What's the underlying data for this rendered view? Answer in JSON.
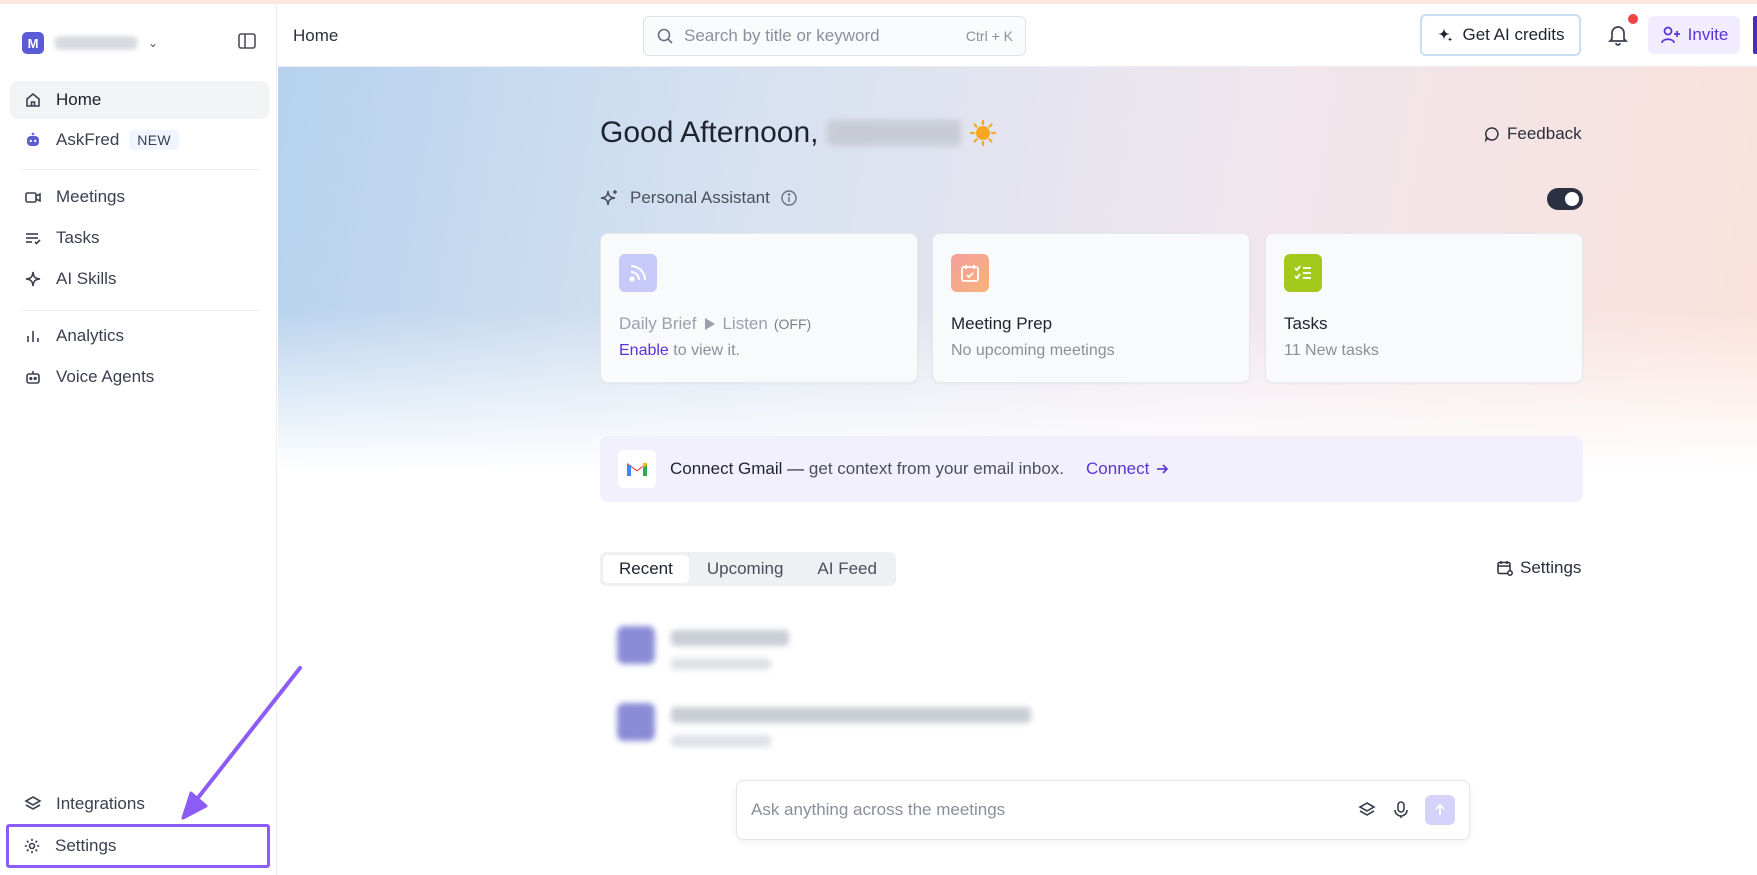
{
  "colors": {
    "accent": "#5b32d6",
    "highlight": "#8b5cf6",
    "notification": "#ef4444"
  },
  "sidebar": {
    "workspace_initial": "M",
    "items": [
      {
        "label": "Home",
        "icon": "home-icon"
      },
      {
        "label": "AskFred",
        "badge": "NEW",
        "icon": "robot-icon"
      },
      {
        "label": "Meetings",
        "icon": "video-icon"
      },
      {
        "label": "Tasks",
        "icon": "tasks-icon"
      },
      {
        "label": "AI Skills",
        "icon": "sparkle-icon"
      },
      {
        "label": "Analytics",
        "icon": "bar-chart-icon"
      },
      {
        "label": "Voice Agents",
        "icon": "bot-icon"
      },
      {
        "label": "Integrations",
        "icon": "layers-icon"
      },
      {
        "label": "Settings",
        "icon": "gear-icon"
      }
    ]
  },
  "header": {
    "breadcrumb": "Home",
    "search_placeholder": "Search by title or keyword",
    "search_shortcut": "Ctrl + K",
    "credits_label": "Get AI credits",
    "invite_label": "Invite"
  },
  "main": {
    "greeting": "Good Afternoon,",
    "feedback_label": "Feedback",
    "assistant_label": "Personal Assistant",
    "cards": [
      {
        "title": "Daily Brief",
        "listen": "Listen",
        "listen_state": "(OFF)",
        "sub_link": "Enable",
        "sub_text": " to view it."
      },
      {
        "title": "Meeting Prep",
        "sub_text": "No upcoming meetings"
      },
      {
        "title": "Tasks",
        "sub_text": "11 New tasks"
      }
    ],
    "gmail": {
      "bold": "Connect Gmail —",
      "text": "get context from your email inbox.",
      "action": "Connect"
    },
    "tabs": [
      "Recent",
      "Upcoming",
      "AI Feed"
    ],
    "list_settings_label": "Settings",
    "ask_placeholder": "Ask anything across the meetings"
  }
}
